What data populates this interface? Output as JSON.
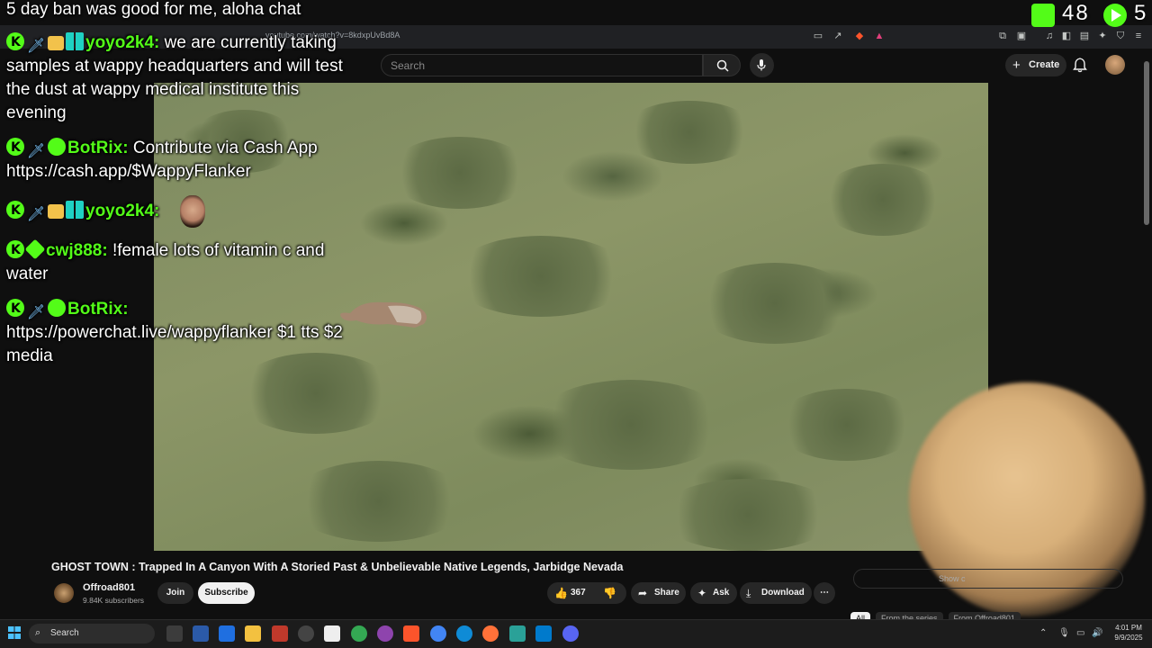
{
  "browser": {
    "url": "youtube.com/watch?v=8kdxpUvBd8A"
  },
  "youtube": {
    "search_placeholder": "Search",
    "create_label": "Create"
  },
  "stream_overlay": {
    "title": "5 day ban was good for me, aloha chat",
    "kick_count": "48",
    "play_count": "5"
  },
  "chat": [
    {
      "user": "yoyo2k4:",
      "message": "we are currently taking samples at wappy headquarters and will test the dust at wappy medical institute this evening"
    },
    {
      "user": "BotRix:",
      "message": "Contribute via Cash App https://cash.app/$WappyFlanker"
    },
    {
      "user": "yoyo2k4:",
      "message": ""
    },
    {
      "user": "cwj888:",
      "message": "!female lots of vitamin c and water"
    },
    {
      "user": "BotRix:",
      "message": "https://powerchat.live/wappyflanker $1 tts $2 media"
    }
  ],
  "video": {
    "title": "GHOST TOWN : Trapped In A Canyon With A Storied Past & Unbelievable Native Legends, Jarbidge Nevada",
    "channel_name": "Offroad801",
    "subscribers": "9.84K subscribers",
    "join_label": "Join",
    "subscribe_label": "Subscribe",
    "likes": "367",
    "share_label": "Share",
    "ask_label": "Ask",
    "download_label": "Download"
  },
  "sidebar": {
    "show_chat_label": "Show c",
    "filters": [
      {
        "label": "All",
        "active": true
      },
      {
        "label": "From the series",
        "active": false
      },
      {
        "label": "From Offroad801",
        "active": false
      }
    ]
  },
  "taskbar": {
    "search_label": "Search",
    "time": "4:01 PM",
    "date": "9/9/2025"
  },
  "colors": {
    "kick_green": "#53fc18",
    "yt_background": "#0f0f0f"
  }
}
